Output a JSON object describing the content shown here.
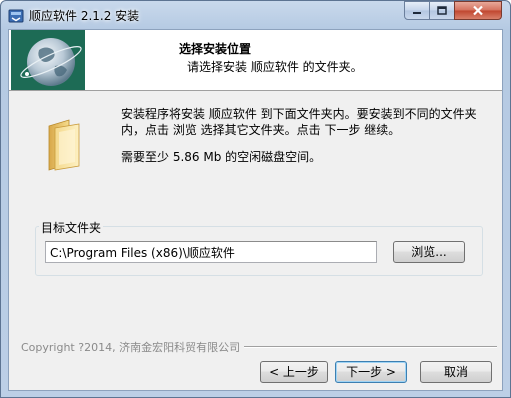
{
  "window": {
    "title": "顺应软件 2.1.2 安装",
    "controls": {
      "minimize": "minimize-icon",
      "maximize": "maximize-icon",
      "close": "close-icon"
    }
  },
  "header": {
    "title": "选择安装位置",
    "subtitle": "请选择安装 顺应软件 的文件夹。"
  },
  "body": {
    "description": "安装程序将安装 顺应软件 到下面文件夹内。要安装到不同的文件夹内，点击 浏览 选择其它文件夹。点击 下一步 继续。",
    "space_required": "需要至少 5.86 Mb 的空闲磁盘空间。"
  },
  "destination": {
    "group_label": "目标文件夹",
    "path_value": "C:\\Program Files (x86)\\顺应软件",
    "browse_label": "浏览..."
  },
  "footer": {
    "copyright": "Copyright ?2014, 济南金宏阳科贸有限公司",
    "back_label": "< 上一步",
    "next_label": "下一步 >",
    "cancel_label": "取消"
  },
  "colors": {
    "logo_bg": "#1d6b55",
    "title_bar": "#b4c9e2",
    "close_button": "#c0452e",
    "folder": "#e8c872"
  }
}
